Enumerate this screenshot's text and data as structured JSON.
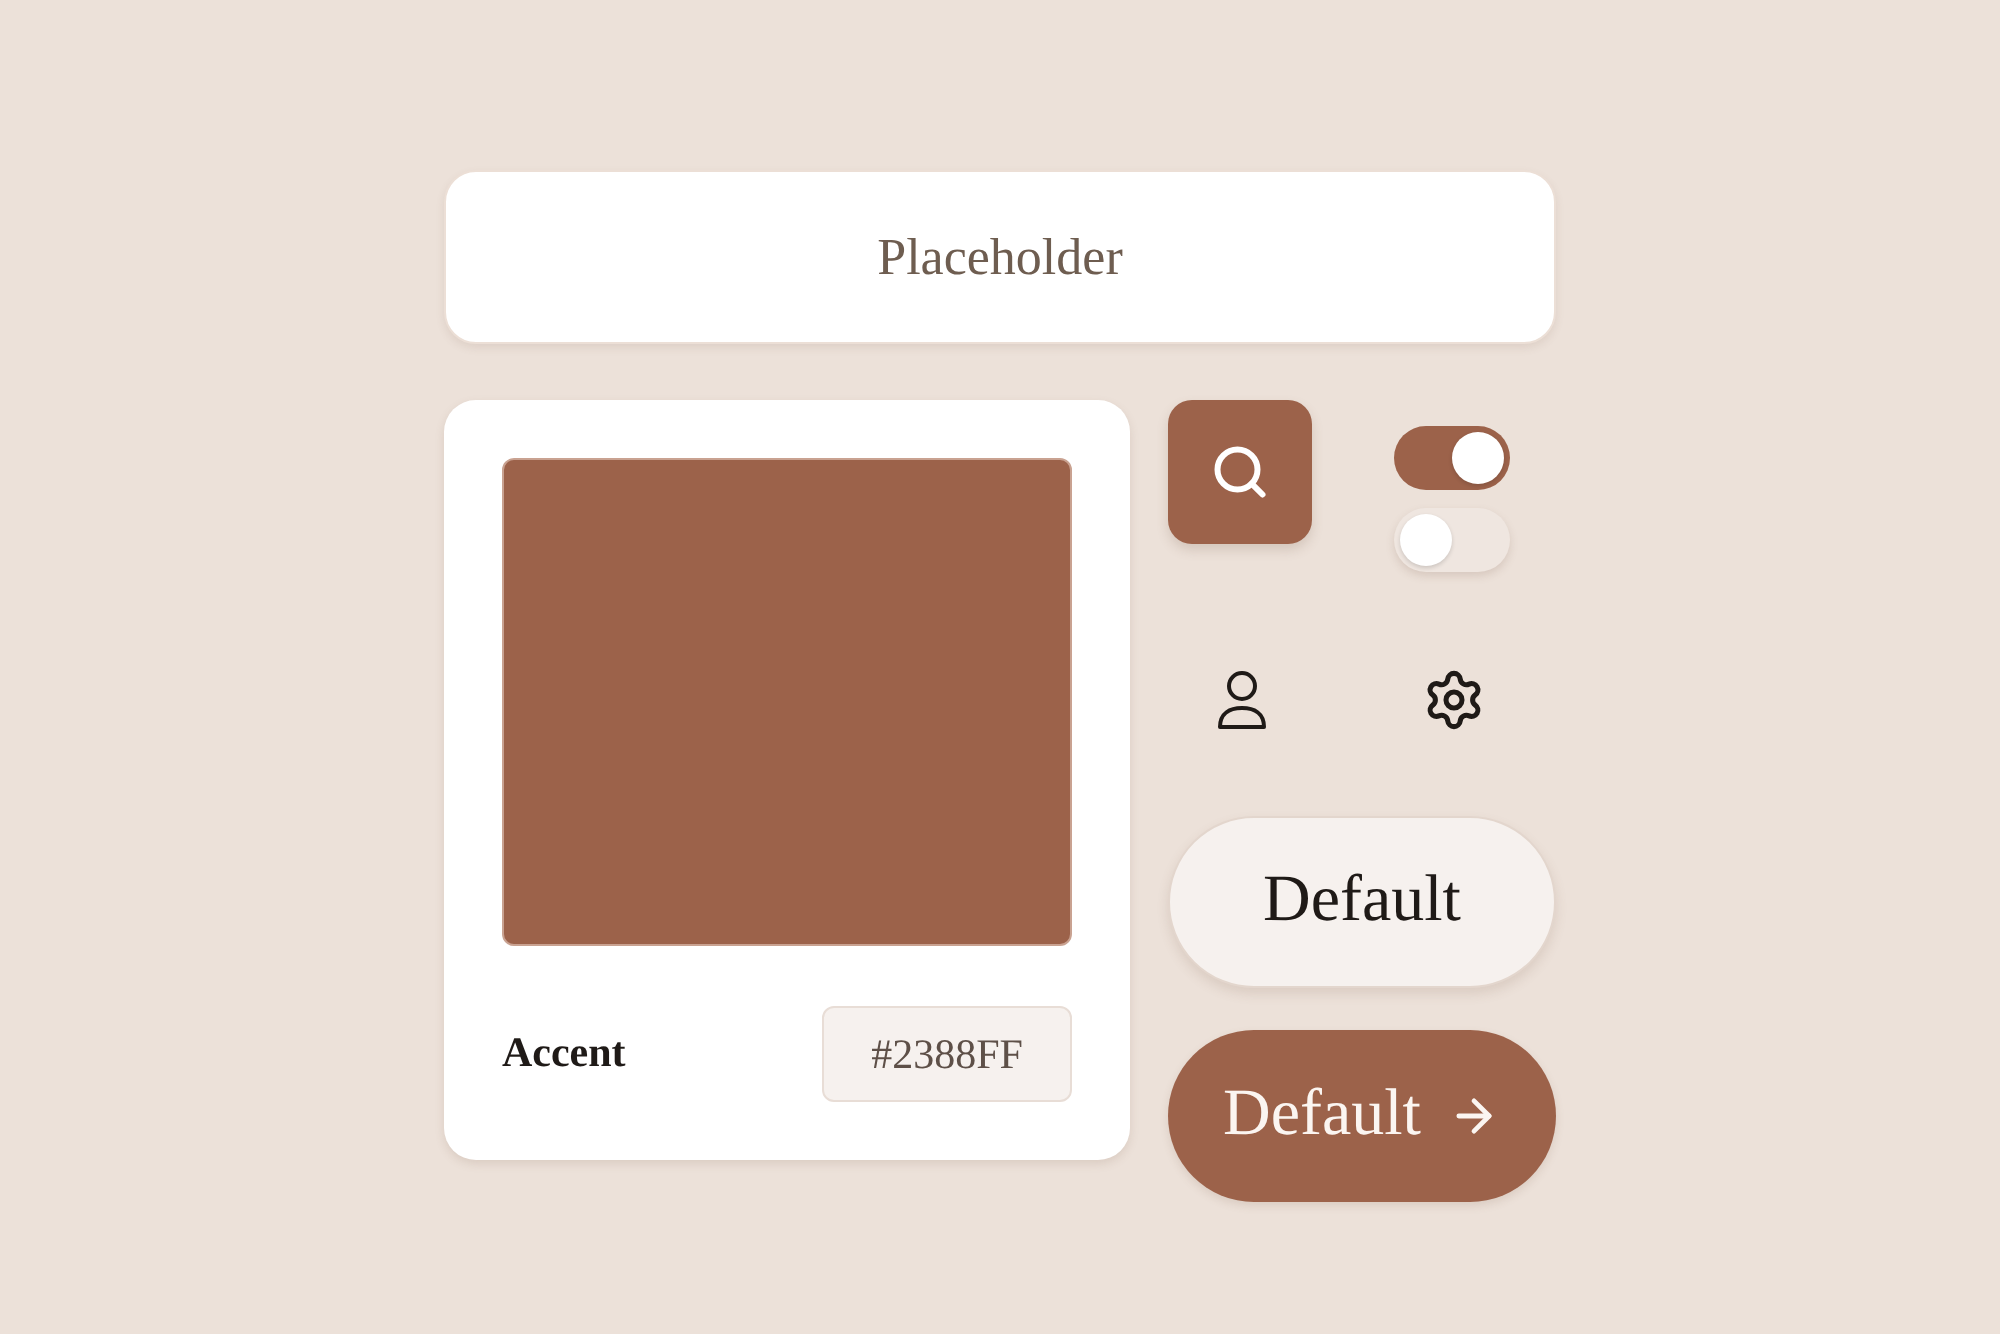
{
  "input": {
    "placeholder": "Placeholder"
  },
  "swatch": {
    "label": "Accent",
    "hex_value": "#2388FF"
  },
  "toggles": [
    {
      "on": true
    },
    {
      "on": false
    }
  ],
  "buttons": [
    {
      "label": "Default",
      "kind": "secondary"
    },
    {
      "label": "Default",
      "kind": "primary"
    }
  ]
}
